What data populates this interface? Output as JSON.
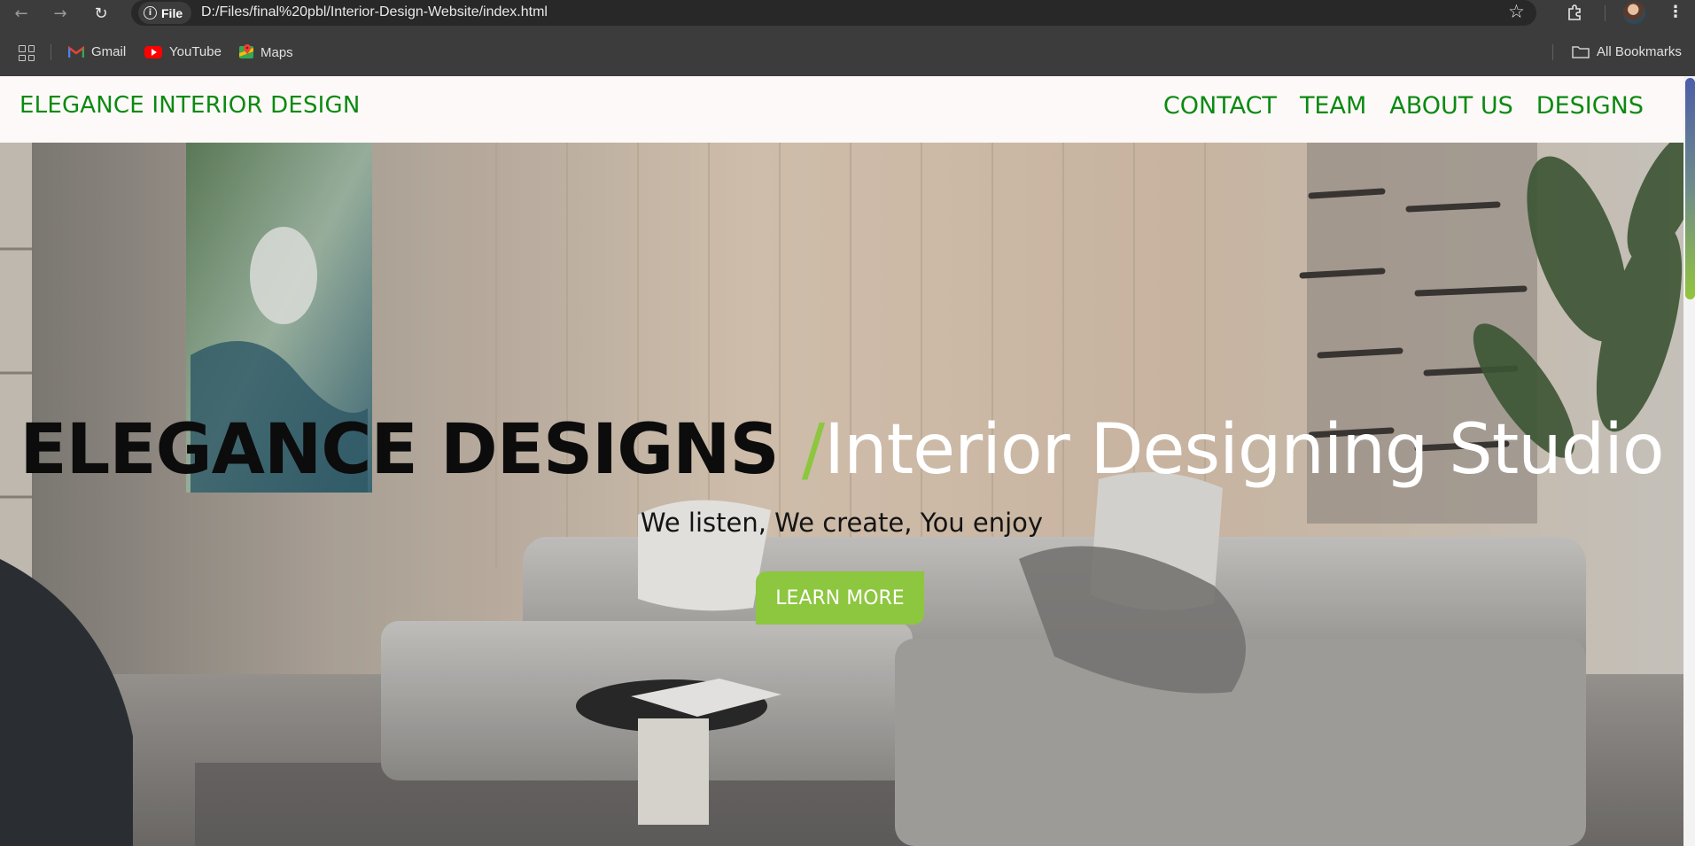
{
  "browser": {
    "file_label": "File",
    "url": "D:/Files/final%20pbl/Interior-Design-Website/index.html",
    "icons": [
      "back-icon",
      "forward-icon",
      "reload-icon",
      "info-icon",
      "star-icon",
      "extensions-icon",
      "avatar",
      "menu-icon"
    ],
    "bookmarks": [
      {
        "label": "Gmail",
        "icon": "gmail-icon"
      },
      {
        "label": "YouTube",
        "icon": "youtube-icon"
      },
      {
        "label": "Maps",
        "icon": "maps-icon"
      }
    ],
    "all_bookmarks_label": "All Bookmarks"
  },
  "site": {
    "brand": "ELEGANCE INTERIOR DESIGN",
    "nav": [
      {
        "label": "CONTACT"
      },
      {
        "label": "TEAM"
      },
      {
        "label": "ABOUT US"
      },
      {
        "label": "DESIGNS"
      }
    ],
    "hero": {
      "title_strong": "ELEGANCE DESIGNS ",
      "title_slash": "/",
      "title_light": "Interior Designing Studio",
      "subtitle": "We listen, We create, You enjoy",
      "cta_label": "LEARN MORE",
      "background": "photo of a modern living room with grey sectional sofa, round coffee table, wall painting, wine rack and plant"
    },
    "colors": {
      "brand_green": "#0b8a12",
      "accent_green": "#8dc63f",
      "nav_bg": "#fdf9f8",
      "browser_bg": "#3c3c3c"
    }
  }
}
